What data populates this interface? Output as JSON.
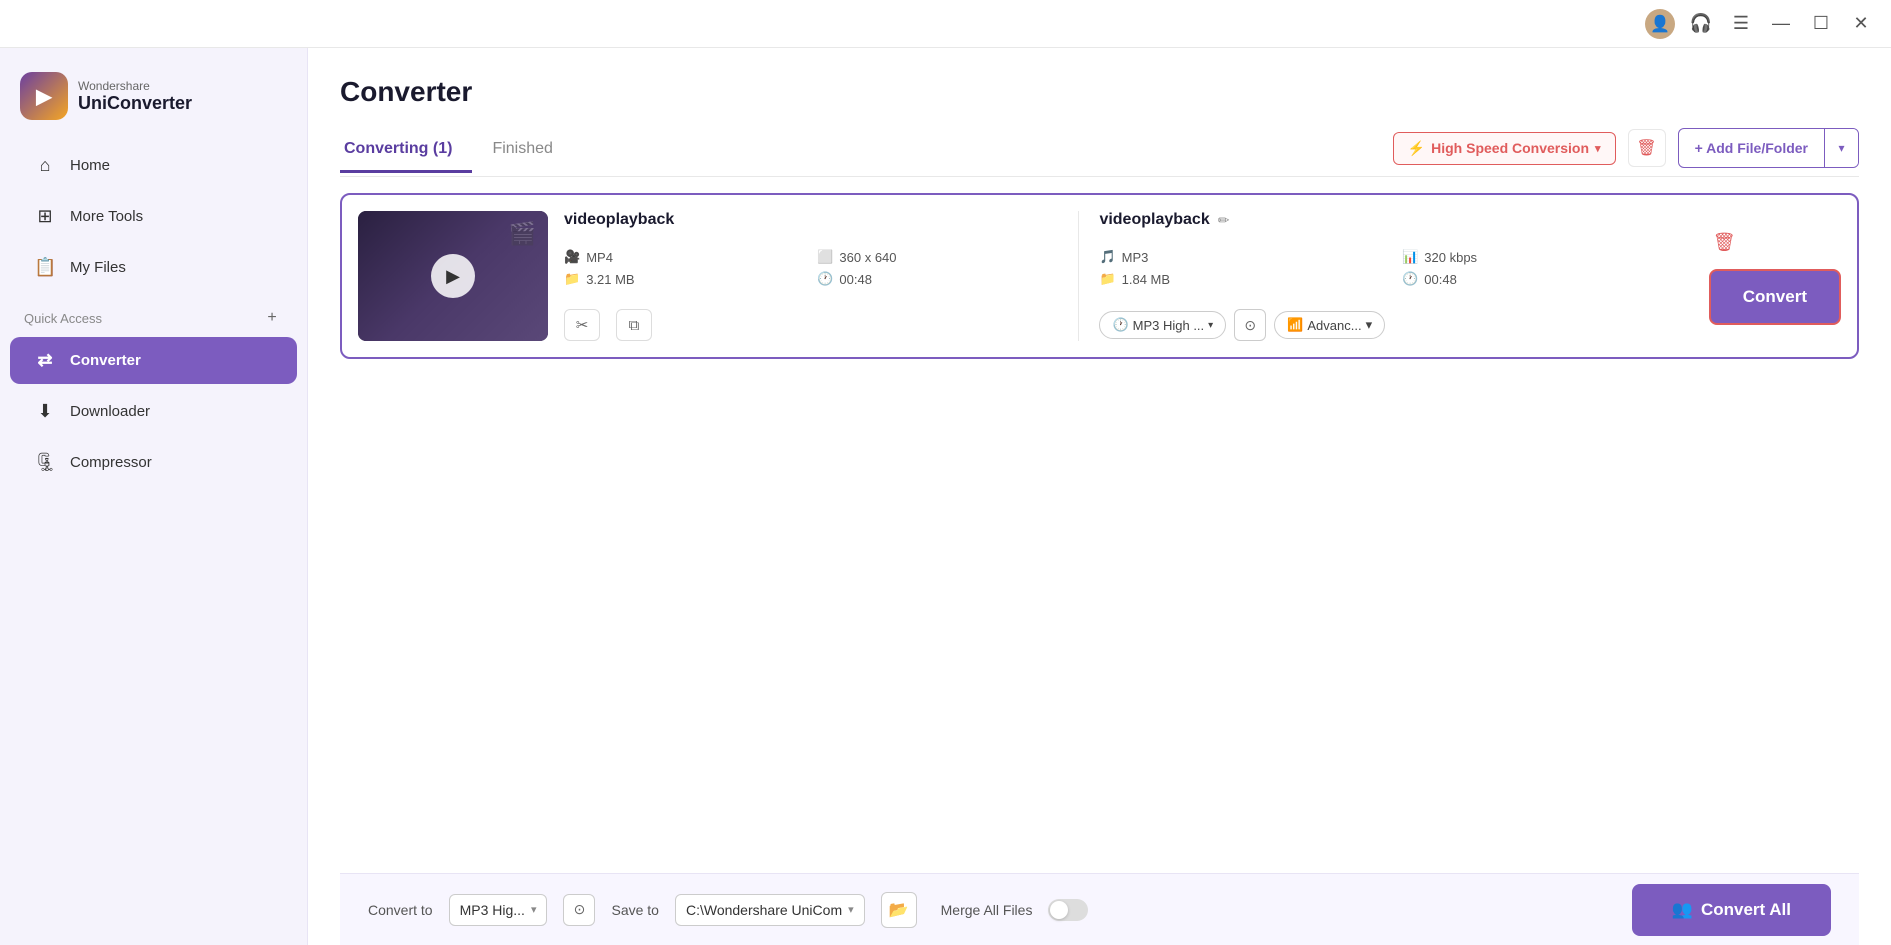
{
  "app": {
    "brand": "Wondershare",
    "product": "UniConverter"
  },
  "titlebar": {
    "user_icon": "👤",
    "headset_icon": "🎧",
    "menu_icon": "☰",
    "minimize_icon": "—",
    "maximize_icon": "☐",
    "close_icon": "✕"
  },
  "sidebar": {
    "items": [
      {
        "id": "home",
        "label": "Home",
        "icon": "⌂"
      },
      {
        "id": "more-tools",
        "label": "More Tools",
        "icon": "⊞"
      },
      {
        "id": "my-files",
        "label": "My Files",
        "icon": "📋"
      }
    ],
    "quick_access_label": "Quick Access",
    "quick_access_plus": "+",
    "main_items": [
      {
        "id": "converter",
        "label": "Converter",
        "icon": "⇄",
        "active": true
      },
      {
        "id": "downloader",
        "label": "Downloader",
        "icon": "⬇"
      },
      {
        "id": "compressor",
        "label": "Compressor",
        "icon": "🗜"
      }
    ]
  },
  "main": {
    "page_title": "Converter",
    "tabs": [
      {
        "id": "converting",
        "label": "Converting (1)",
        "active": true
      },
      {
        "id": "finished",
        "label": "Finished"
      }
    ],
    "high_speed_label": "High Speed Conversion",
    "delete_tooltip": "Delete",
    "add_file_label": "+ Add File/Folder",
    "add_file_dropdown": "▾"
  },
  "file_card": {
    "source": {
      "name": "videoplayback",
      "format": "MP4",
      "resolution": "360 x 640",
      "size": "3.21 MB",
      "duration": "00:48"
    },
    "target": {
      "name": "videoplayback",
      "format": "MP3",
      "bitrate": "320 kbps",
      "size": "1.84 MB",
      "duration": "00:48",
      "quality": "MP3 High ...",
      "advanced": "Advanc..."
    },
    "convert_btn_label": "Convert",
    "scissors_icon": "✂",
    "copy_icon": "⧉"
  },
  "bottom_bar": {
    "convert_to_label": "Convert to",
    "convert_to_value": "MP3 Hig...",
    "save_to_label": "Save to",
    "save_to_value": "C:\\Wondershare UniCom",
    "merge_label": "Merge All Files",
    "convert_all_label": "Convert All"
  }
}
